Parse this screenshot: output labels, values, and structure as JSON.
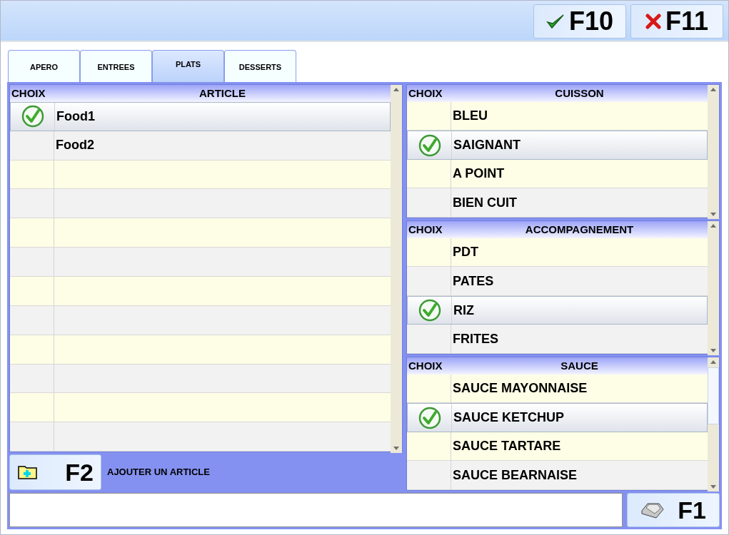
{
  "toolbar": {
    "buttons": [
      {
        "kind": "confirm",
        "label": "F10"
      },
      {
        "kind": "cancel",
        "label": "F11"
      }
    ]
  },
  "tabs": [
    {
      "label": "APERO",
      "selected": false
    },
    {
      "label": "ENTREES",
      "selected": false
    },
    {
      "label": "PLATS",
      "selected": true
    },
    {
      "label": "DESSERTS",
      "selected": false
    }
  ],
  "articles": {
    "columns": [
      "CHOIX",
      "ARTICLE"
    ],
    "rows": [
      {
        "label": "Food1",
        "selected": true
      },
      {
        "label": "Food2",
        "selected": false
      }
    ]
  },
  "add_button": {
    "label": "F2",
    "caption": "AJOUTER UN ARTICLE"
  },
  "options": [
    {
      "columns": [
        "CHOIX",
        "CUISSON"
      ],
      "rows": [
        {
          "label": "BLEU",
          "selected": false
        },
        {
          "label": "SAIGNANT",
          "selected": true
        },
        {
          "label": "A POINT",
          "selected": false
        },
        {
          "label": "BIEN CUIT",
          "selected": false
        }
      ]
    },
    {
      "columns": [
        "CHOIX",
        "ACCOMPAGNEMENT"
      ],
      "rows": [
        {
          "label": "PDT",
          "selected": false
        },
        {
          "label": "PATES",
          "selected": false
        },
        {
          "label": "RIZ",
          "selected": true
        },
        {
          "label": "FRITES",
          "selected": false
        }
      ]
    },
    {
      "columns": [
        "CHOIX",
        "SAUCE"
      ],
      "rows": [
        {
          "label": "SAUCE MAYONNAISE",
          "selected": false
        },
        {
          "label": "SAUCE KETCHUP",
          "selected": true
        },
        {
          "label": "SAUCE TARTARE",
          "selected": false
        },
        {
          "label": "SAUCE BEARNAISE",
          "selected": false
        }
      ]
    }
  ],
  "keyboard_button": {
    "label": "F1"
  }
}
